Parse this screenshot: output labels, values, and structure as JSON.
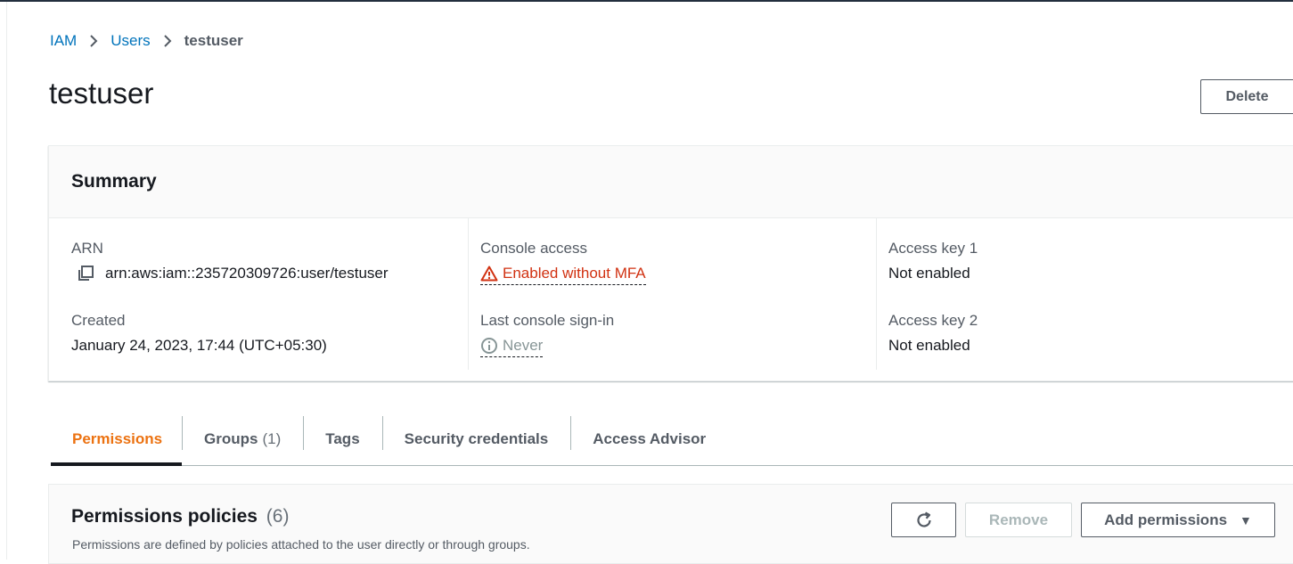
{
  "breadcrumb": {
    "root": "IAM",
    "parent": "Users",
    "current": "testuser"
  },
  "page": {
    "title": "testuser",
    "delete_label": "Delete"
  },
  "summary": {
    "title": "Summary",
    "arn_label": "ARN",
    "arn_value": "arn:aws:iam::235720309726:user/testuser",
    "created_label": "Created",
    "created_value": "January 24, 2023, 17:44 (UTC+05:30)",
    "console_access_label": "Console access",
    "console_access_value": "Enabled without MFA",
    "last_signin_label": "Last console sign-in",
    "last_signin_value": "Never",
    "access_key1_label": "Access key 1",
    "access_key1_value": "Not enabled",
    "access_key2_label": "Access key 2",
    "access_key2_value": "Not enabled"
  },
  "tabs": [
    {
      "label": "Permissions",
      "count": "",
      "active": true
    },
    {
      "label": "Groups",
      "count": "(1)",
      "active": false
    },
    {
      "label": "Tags",
      "count": "",
      "active": false
    },
    {
      "label": "Security credentials",
      "count": "",
      "active": false
    },
    {
      "label": "Access Advisor",
      "count": "",
      "active": false
    }
  ],
  "policies": {
    "title": "Permissions policies",
    "count": "(6)",
    "description": "Permissions are defined by policies attached to the user directly or through groups.",
    "remove_label": "Remove",
    "add_label": "Add permissions"
  },
  "colors": {
    "link": "#0073bb",
    "active_tab": "#ec7211",
    "warning": "#d13212",
    "muted": "#879596"
  },
  "icons": [
    "chevron-right-icon",
    "copy-icon",
    "warning-icon",
    "info-icon",
    "refresh-icon",
    "caret-down-icon"
  ]
}
